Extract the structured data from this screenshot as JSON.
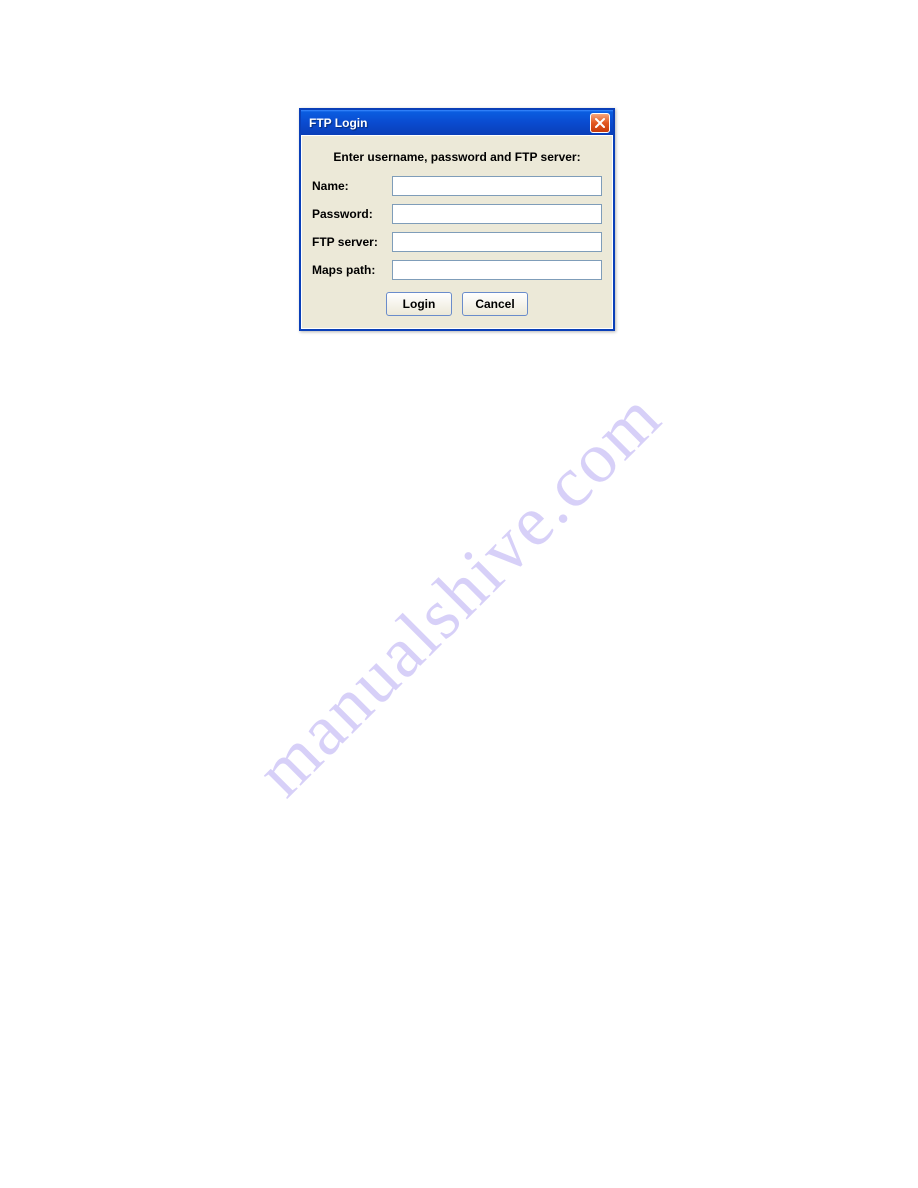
{
  "dialog": {
    "title": "FTP Login",
    "instruction": "Enter username, password and FTP server:",
    "fields": {
      "name": {
        "label": "Name:",
        "value": ""
      },
      "password": {
        "label": "Password:",
        "value": ""
      },
      "ftpserver": {
        "label": "FTP server:",
        "value": ""
      },
      "mapspath": {
        "label": "Maps path:",
        "value": ""
      }
    },
    "buttons": {
      "login": "Login",
      "cancel": "Cancel"
    }
  },
  "watermark": "manualshive.com"
}
